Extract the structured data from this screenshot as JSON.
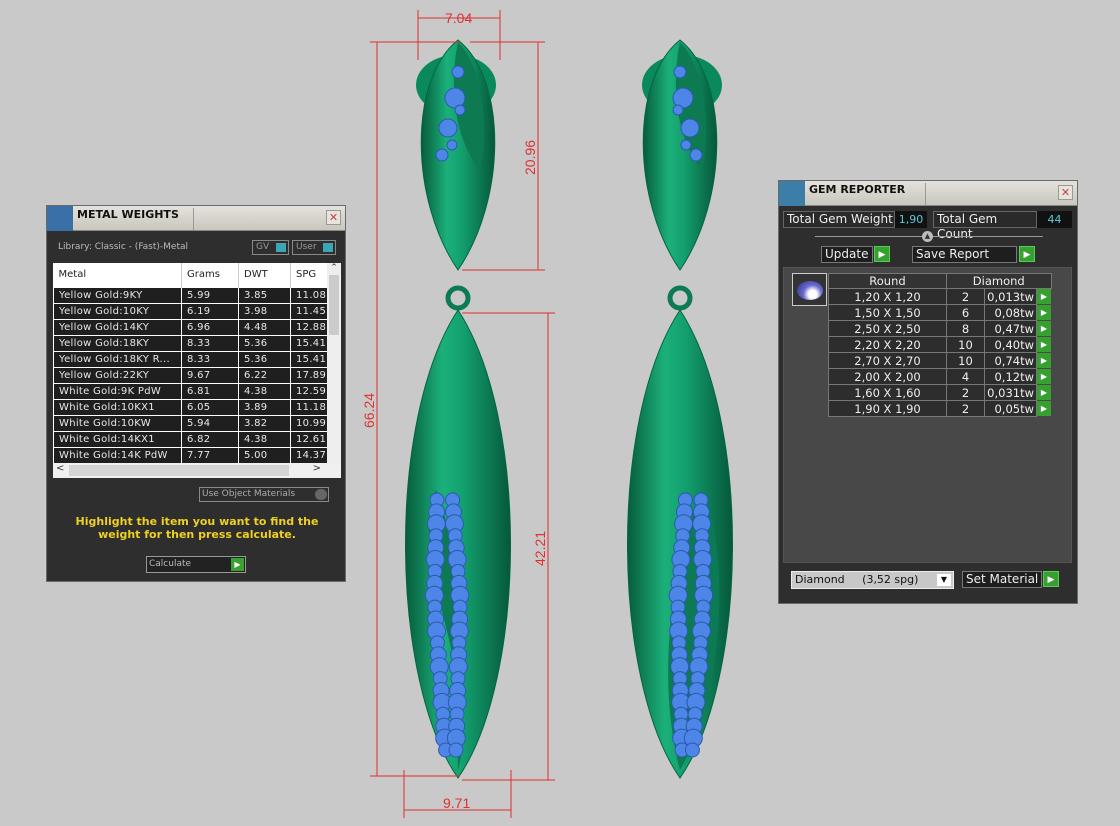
{
  "drawing": {
    "dimensions": {
      "top_width": "7.04",
      "top_height": "20.96",
      "total_height": "66.24",
      "drop_height": "42.21",
      "bottom_width": "9.71"
    },
    "colors": {
      "metal": "#0f9a6a",
      "gem": "#4d86e6",
      "dimension": "#e03030"
    }
  },
  "metal_weights": {
    "title": "METAL WEIGHTS",
    "close": "✕",
    "library": "Library: Classic - (Fast)-Metal",
    "toggle_gv": "GV",
    "toggle_user": "User",
    "columns": [
      "Metal",
      "Grams",
      "DWT",
      "SPG"
    ],
    "rows": [
      [
        "Yellow Gold:9KY",
        "5.99",
        "3.85",
        "11.08"
      ],
      [
        "Yellow Gold:10KY",
        "6.19",
        "3.98",
        "11.45"
      ],
      [
        "Yellow Gold:14KY",
        "6.96",
        "4.48",
        "12.88"
      ],
      [
        "Yellow Gold:18KY",
        "8.33",
        "5.36",
        "15.41"
      ],
      [
        "Yellow Gold:18KY R...",
        "8.33",
        "5.36",
        "15.41"
      ],
      [
        "Yellow Gold:22KY",
        "9.67",
        "6.22",
        "17.89"
      ],
      [
        "White Gold:9K PdW",
        "6.81",
        "4.38",
        "12.59"
      ],
      [
        "White Gold:10KX1",
        "6.05",
        "3.89",
        "11.18"
      ],
      [
        "White Gold:10KW",
        "5.94",
        "3.82",
        "10.99"
      ],
      [
        "White Gold:14KX1",
        "6.82",
        "4.38",
        "12.61"
      ],
      [
        "White Gold:14K PdW",
        "7.77",
        "5.00",
        "14.37"
      ]
    ],
    "use_object_materials": "Use Object Materials",
    "hint": "Highlight the item you want to find the weight for then press calculate.",
    "calculate": "Calculate"
  },
  "gem_reporter": {
    "title": "GEM REPORTER",
    "close": "✕",
    "total_weight_label": "Total Gem Weight",
    "total_weight": "1,90",
    "total_count_label": "Total Gem Count",
    "total_count": "44",
    "update": "Update",
    "save_report": "Save Report",
    "col_shape": "Round",
    "col_material": "Diamond",
    "rows": [
      [
        "1,20 X 1,20",
        "2",
        "0,013tw"
      ],
      [
        "1,50 X 1,50",
        "6",
        "0,08tw"
      ],
      [
        "2,50 X 2,50",
        "8",
        "0,47tw"
      ],
      [
        "2,20 X 2,20",
        "10",
        "0,40tw"
      ],
      [
        "2,70 X 2,70",
        "10",
        "0,74tw"
      ],
      [
        "2,00 X 2,00",
        "4",
        "0,12tw"
      ],
      [
        "1,60 X 1,60",
        "2",
        "0,031tw"
      ],
      [
        "1,90 X 1,90",
        "2",
        "0,05tw"
      ]
    ],
    "material_select": "Diamond     (3,52 spg)",
    "set_material": "Set Material"
  }
}
